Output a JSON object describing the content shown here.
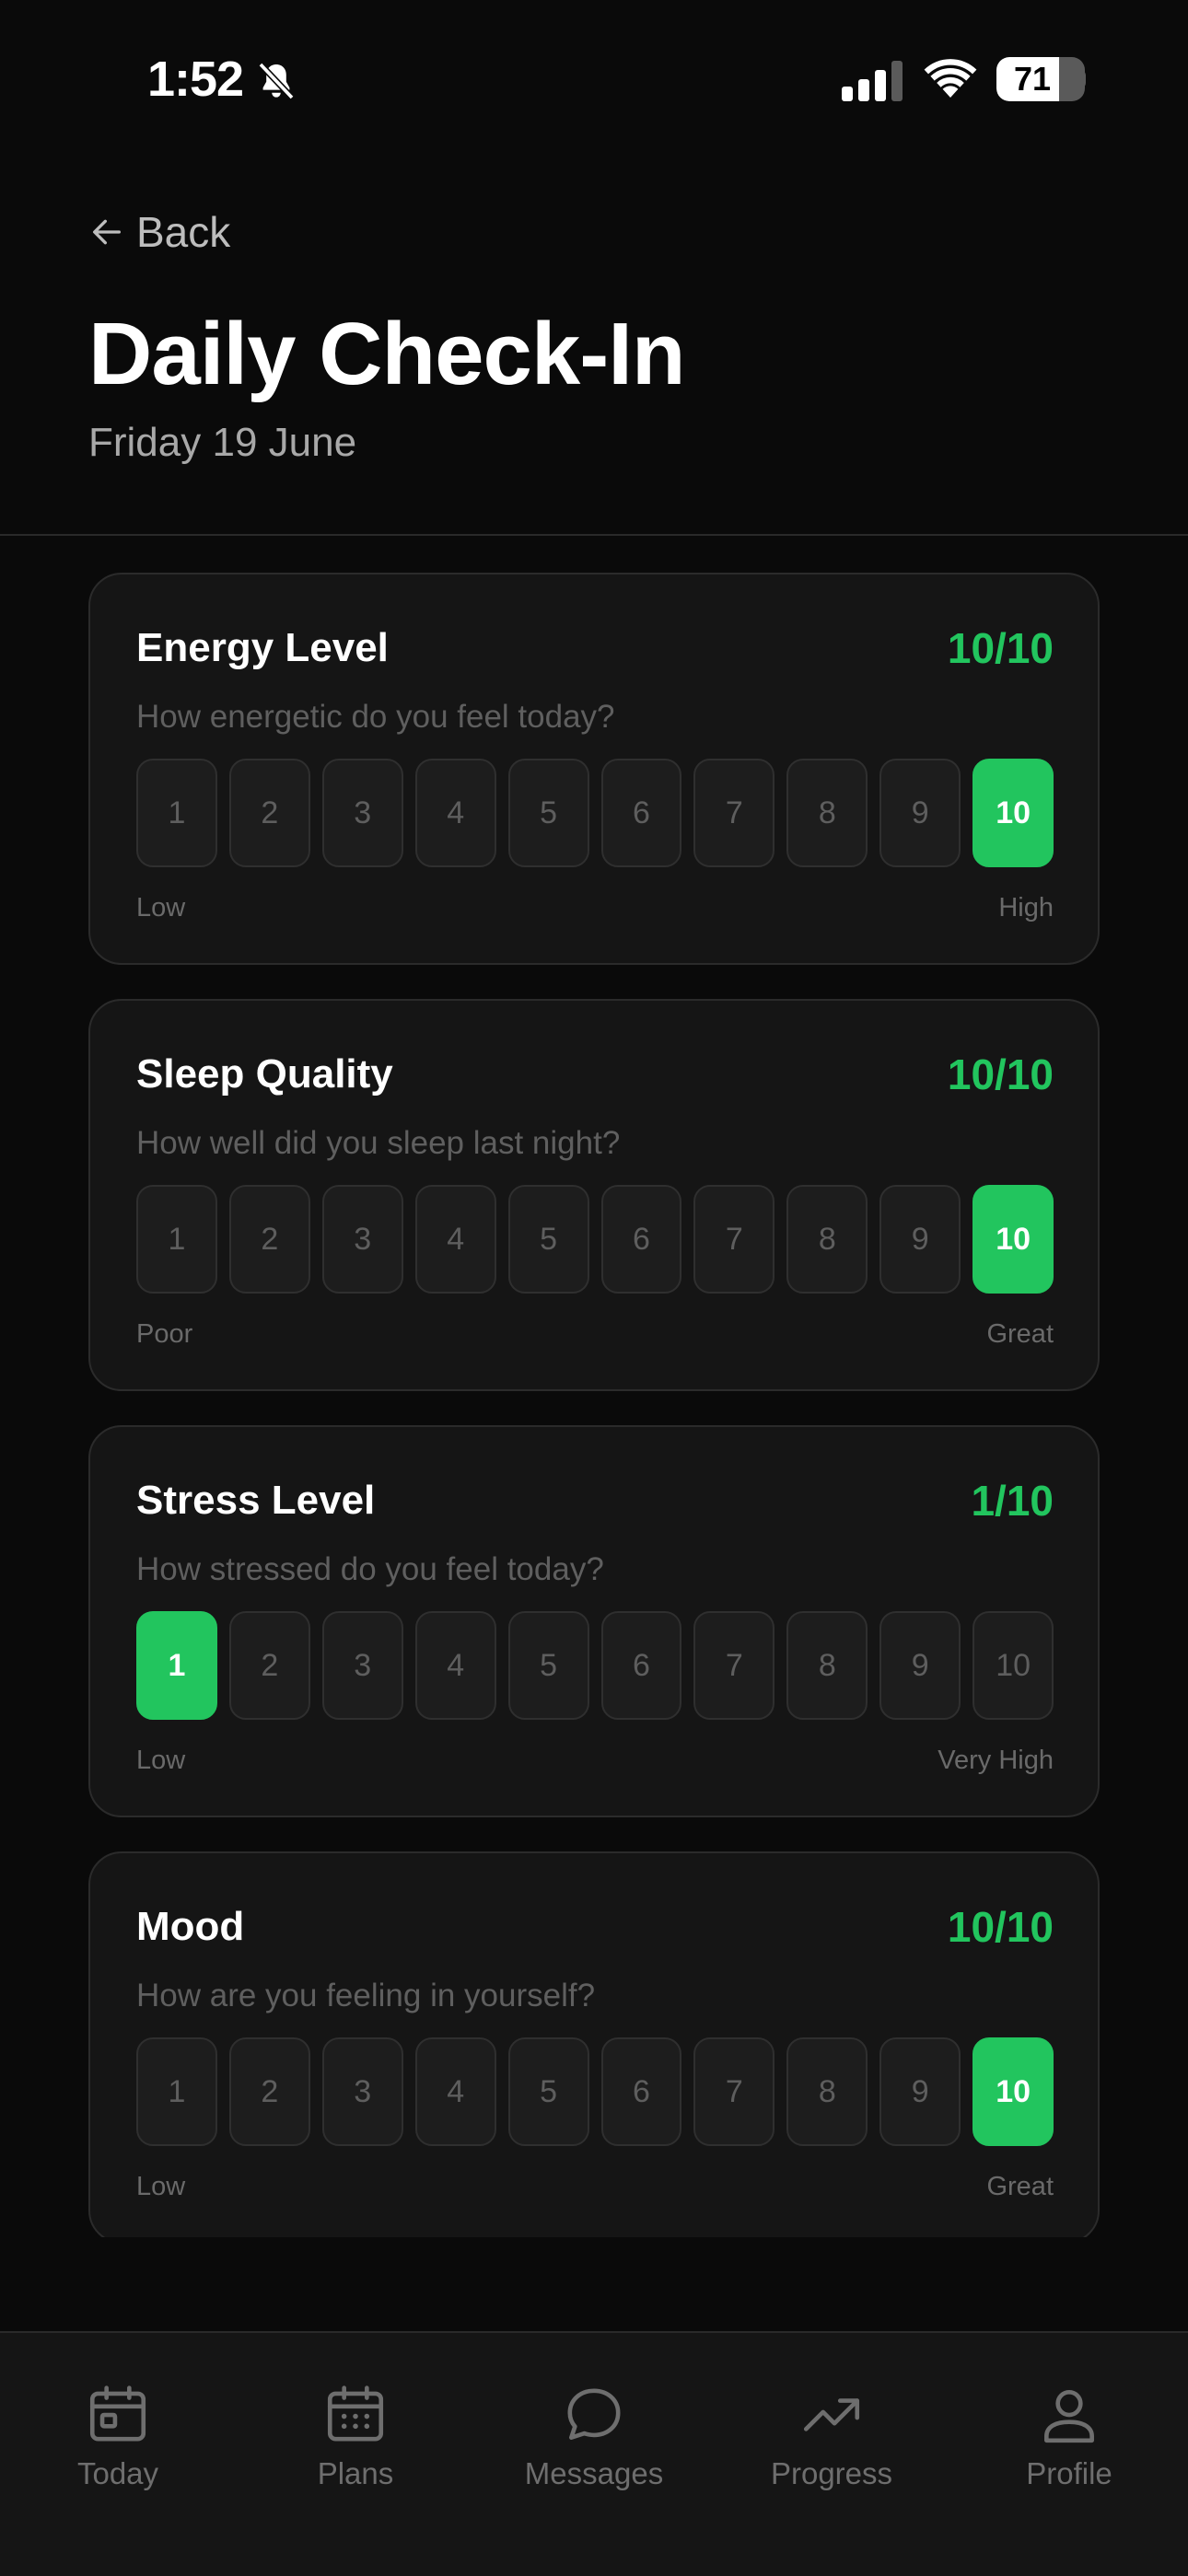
{
  "status_bar": {
    "time": "1:52",
    "battery": "71",
    "battery_level": 0.71
  },
  "header": {
    "back_label": "Back",
    "title": "Daily Check-In",
    "date": "Friday 19 June"
  },
  "scale_options": [
    "1",
    "2",
    "3",
    "4",
    "5",
    "6",
    "7",
    "8",
    "9",
    "10"
  ],
  "cards": [
    {
      "title": "Energy Level",
      "score": "10/10",
      "selected": 10,
      "question": "How energetic do you feel today?",
      "low_label": "Low",
      "high_label": "High"
    },
    {
      "title": "Sleep Quality",
      "score": "10/10",
      "selected": 10,
      "question": "How well did you sleep last night?",
      "low_label": "Poor",
      "high_label": "Great"
    },
    {
      "title": "Stress Level",
      "score": "1/10",
      "selected": 1,
      "question": "How stressed do you feel today?",
      "low_label": "Low",
      "high_label": "Very High"
    },
    {
      "title": "Mood",
      "score": "10/10",
      "selected": 10,
      "question": "How are you feeling in yourself?",
      "low_label": "Low",
      "high_label": "Great"
    }
  ],
  "nav": {
    "items": [
      {
        "label": "Today",
        "icon": "calendar-today-icon"
      },
      {
        "label": "Plans",
        "icon": "calendar-grid-icon"
      },
      {
        "label": "Messages",
        "icon": "chat-bubble-icon"
      },
      {
        "label": "Progress",
        "icon": "trending-up-icon"
      },
      {
        "label": "Profile",
        "icon": "user-icon"
      }
    ]
  },
  "colors": {
    "accent": "#22c55e",
    "background": "#0a0a0a",
    "card": "#151515"
  }
}
